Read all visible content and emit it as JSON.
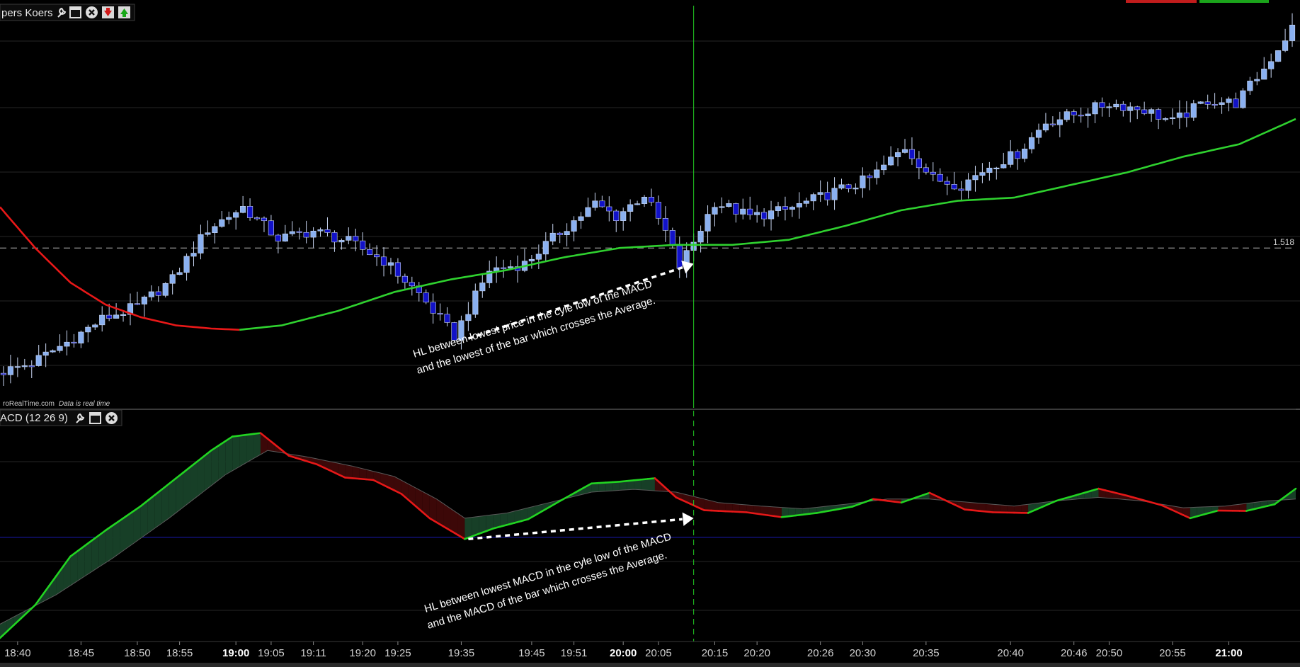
{
  "colors": {
    "background": "#000000",
    "grid": "#262626",
    "bull_body": "#8ab0f0",
    "bear_body": "#1212c8",
    "candle_outline": "#c9d6f2",
    "avg_down": "#e81818",
    "avg_up": "#2fd12f",
    "cursor": "#22cc22",
    "macd_up": "#22d422",
    "macd_down": "#e61818",
    "fill_up": "#173f27",
    "fill_down": "#3c0808",
    "zero_line": "#1818b0",
    "signal_line": "#5a5a5a"
  },
  "price_panel": {
    "title": "pers Koers",
    "credit": "roRealTime.com",
    "credit_note": "Data is real time",
    "level_label": "1.518",
    "toolbar_icons": [
      "wrench-icon",
      "window-icon",
      "close-icon",
      "move-down-icon",
      "move-up-icon"
    ]
  },
  "macd_panel": {
    "title": "ACD (12 26 9)",
    "toolbar_icons": [
      "wrench-icon",
      "window-icon",
      "close-icon"
    ]
  },
  "annotations": {
    "price_line1": "HL between lowest price in the cyle low of  the MACD",
    "price_line2": "and the lowest of the bar which crosses the Average.",
    "macd_line1": "HL between lowest MACD in the cyle low of  the MACD",
    "macd_line2": "and the MACD of the bar which crosses the Average."
  },
  "x_axis": {
    "ticks": [
      {
        "bar": 2,
        "label": "18:40",
        "bold": false
      },
      {
        "bar": 11,
        "label": "18:45",
        "bold": false
      },
      {
        "bar": 19,
        "label": "18:50",
        "bold": false
      },
      {
        "bar": 25,
        "label": "18:55",
        "bold": false
      },
      {
        "bar": 33,
        "label": "19:00",
        "bold": true
      },
      {
        "bar": 38,
        "label": "19:05",
        "bold": false
      },
      {
        "bar": 44,
        "label": "19:11",
        "bold": false
      },
      {
        "bar": 51,
        "label": "19:20",
        "bold": false
      },
      {
        "bar": 56,
        "label": "19:25",
        "bold": false
      },
      {
        "bar": 65,
        "label": "19:35",
        "bold": false
      },
      {
        "bar": 75,
        "label": "19:45",
        "bold": false
      },
      {
        "bar": 81,
        "label": "19:51",
        "bold": false
      },
      {
        "bar": 88,
        "label": "20:00",
        "bold": true
      },
      {
        "bar": 93,
        "label": "20:05",
        "bold": false
      },
      {
        "bar": 101,
        "label": "20:15",
        "bold": false
      },
      {
        "bar": 107,
        "label": "20:20",
        "bold": false
      },
      {
        "bar": 116,
        "label": "20:26",
        "bold": false
      },
      {
        "bar": 122,
        "label": "20:30",
        "bold": false
      },
      {
        "bar": 131,
        "label": "20:35",
        "bold": false
      },
      {
        "bar": 143,
        "label": "20:40",
        "bold": false
      },
      {
        "bar": 152,
        "label": "20:46",
        "bold": false
      },
      {
        "bar": 157,
        "label": "20:50",
        "bold": false
      },
      {
        "bar": 166,
        "label": "20:55",
        "bold": false
      },
      {
        "bar": 174,
        "label": "21:00",
        "bold": true
      }
    ]
  },
  "chart_data": [
    {
      "type": "candlestick",
      "title": "",
      "xlabel": "",
      "ylabel": "",
      "bars": 184,
      "reference_level": 1.518,
      "cursor_bar": 98,
      "close_points": [
        [
          0,
          0.46
        ],
        [
          5,
          0.62
        ],
        [
          10,
          0.95
        ],
        [
          15,
          1.32
        ],
        [
          20,
          1.52
        ],
        [
          25,
          1.95
        ],
        [
          30,
          2.75
        ],
        [
          35,
          3.1
        ],
        [
          40,
          2.6
        ],
        [
          45,
          2.72
        ],
        [
          50,
          2.55
        ],
        [
          55,
          2.25
        ],
        [
          60,
          1.72
        ],
        [
          65,
          1.05
        ],
        [
          70,
          2.1
        ],
        [
          75,
          2.2
        ],
        [
          80,
          2.7
        ],
        [
          85,
          3.15
        ],
        [
          88,
          2.95
        ],
        [
          92,
          3.3
        ],
        [
          95,
          2.7
        ],
        [
          97,
          2.15
        ],
        [
          99,
          2.55
        ],
        [
          102,
          3.18
        ],
        [
          107,
          2.95
        ],
        [
          112,
          3.05
        ],
        [
          118,
          3.3
        ],
        [
          124,
          3.55
        ],
        [
          129,
          4.05
        ],
        [
          133,
          3.55
        ],
        [
          137,
          3.45
        ],
        [
          141,
          3.75
        ],
        [
          145,
          3.95
        ],
        [
          149,
          4.45
        ],
        [
          154,
          4.6
        ],
        [
          158,
          4.75
        ],
        [
          163,
          4.65
        ],
        [
          167,
          4.45
        ],
        [
          172,
          4.8
        ],
        [
          176,
          4.75
        ],
        [
          180,
          5.3
        ],
        [
          184,
          5.95
        ]
      ],
      "average_points": [
        [
          0,
          3.1
        ],
        [
          5,
          2.45
        ],
        [
          10,
          1.9
        ],
        [
          15,
          1.55
        ],
        [
          20,
          1.35
        ],
        [
          25,
          1.22
        ],
        [
          30,
          1.17
        ],
        [
          34,
          1.15
        ],
        [
          40,
          1.22
        ],
        [
          48,
          1.45
        ],
        [
          56,
          1.75
        ],
        [
          64,
          1.95
        ],
        [
          72,
          2.1
        ],
        [
          80,
          2.3
        ],
        [
          88,
          2.45
        ],
        [
          96,
          2.5
        ],
        [
          104,
          2.5
        ],
        [
          112,
          2.58
        ],
        [
          120,
          2.8
        ],
        [
          128,
          3.05
        ],
        [
          136,
          3.2
        ],
        [
          144,
          3.25
        ],
        [
          152,
          3.45
        ],
        [
          160,
          3.65
        ],
        [
          168,
          3.9
        ],
        [
          176,
          4.1
        ],
        [
          184,
          4.5
        ]
      ],
      "average_color_change_bar": 34,
      "annotation_from": [
        66,
        1.01
      ],
      "annotation_to": [
        98,
        2.2
      ]
    },
    {
      "type": "line",
      "title": "",
      "xlabel": "",
      "ylabel": "",
      "series": [
        {
          "values": [
            [
              0,
              -2.9
            ],
            [
              5,
              -1.95
            ],
            [
              10,
              -0.55
            ],
            [
              15,
              0.2
            ],
            [
              20,
              0.9
            ],
            [
              25,
              1.7
            ],
            [
              30,
              2.5
            ],
            [
              33,
              2.9
            ],
            [
              37,
              3.0
            ],
            [
              41,
              2.35
            ],
            [
              45,
              2.1
            ],
            [
              49,
              1.72
            ],
            [
              53,
              1.65
            ],
            [
              57,
              1.25
            ],
            [
              61,
              0.55
            ],
            [
              66,
              -0.05
            ],
            [
              70,
              0.25
            ],
            [
              75,
              0.52
            ],
            [
              80,
              1.1
            ],
            [
              84,
              1.55
            ],
            [
              88,
              1.6
            ],
            [
              93,
              1.7
            ],
            [
              96,
              1.15
            ],
            [
              100,
              0.78
            ],
            [
              106,
              0.72
            ],
            [
              111,
              0.58
            ],
            [
              116,
              0.7
            ],
            [
              121,
              0.88
            ],
            [
              124,
              1.1
            ],
            [
              128,
              1.0
            ],
            [
              132,
              1.28
            ],
            [
              137,
              0.8
            ],
            [
              141,
              0.72
            ],
            [
              146,
              0.7
            ],
            [
              150,
              1.05
            ],
            [
              156,
              1.4
            ],
            [
              160,
              1.2
            ],
            [
              165,
              0.92
            ],
            [
              169,
              0.55
            ],
            [
              173,
              0.77
            ],
            [
              177,
              0.76
            ],
            [
              181,
              0.95
            ],
            [
              184,
              1.4
            ]
          ]
        },
        {
          "values": [
            [
              0,
              -2.5
            ],
            [
              8,
              -1.65
            ],
            [
              16,
              -0.6
            ],
            [
              24,
              0.55
            ],
            [
              32,
              1.8
            ],
            [
              38,
              2.5
            ],
            [
              44,
              2.3
            ],
            [
              50,
              2.05
            ],
            [
              56,
              1.75
            ],
            [
              62,
              1.1
            ],
            [
              66,
              0.55
            ],
            [
              72,
              0.7
            ],
            [
              78,
              1.0
            ],
            [
              84,
              1.3
            ],
            [
              90,
              1.38
            ],
            [
              96,
              1.3
            ],
            [
              102,
              1.0
            ],
            [
              108,
              0.9
            ],
            [
              114,
              0.82
            ],
            [
              120,
              0.95
            ],
            [
              126,
              1.1
            ],
            [
              132,
              1.1
            ],
            [
              138,
              1.0
            ],
            [
              144,
              0.9
            ],
            [
              150,
              1.05
            ],
            [
              156,
              1.15
            ],
            [
              162,
              1.05
            ],
            [
              168,
              0.85
            ],
            [
              174,
              0.9
            ],
            [
              180,
              1.05
            ],
            [
              184,
              1.1
            ]
          ]
        }
      ],
      "zero_level": 0,
      "annotation_from": [
        66,
        -0.05
      ],
      "annotation_to": [
        98,
        0.55
      ]
    }
  ]
}
